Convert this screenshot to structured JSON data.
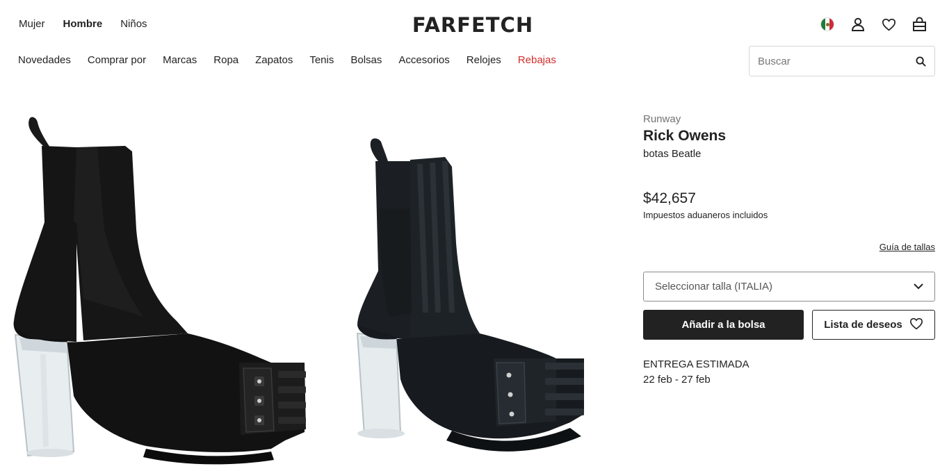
{
  "header": {
    "gender_tabs": [
      {
        "label": "Mujer"
      },
      {
        "label": "Hombre",
        "active": true
      },
      {
        "label": "Niños"
      }
    ],
    "logo": "FARFETCH",
    "icons": [
      "mexico-flag-icon",
      "account-icon",
      "wishlist-heart-icon",
      "shopping-bag-icon"
    ],
    "categories": [
      "Novedades",
      "Comprar por",
      "Marcas",
      "Ropa",
      "Zapatos",
      "Tenis",
      "Bolsas",
      "Accesorios",
      "Relojes",
      "Rebajas"
    ],
    "sale_color": "#d32e2e",
    "search": {
      "placeholder": "Buscar"
    }
  },
  "product": {
    "label": "Runway",
    "brand": "Rick Owens",
    "name": "botas Beatle",
    "price": "$42,657",
    "duties_note": "Impuestos aduaneros incluidos",
    "size_guide": "Guía de tallas",
    "size_select": "Seleccionar talla (ITALIA)",
    "add_to_bag": "Añadir a la bolsa",
    "wishlist": "Lista de deseos",
    "delivery_title": "ENTREGA ESTIMADA",
    "delivery_dates": "22 feb - 27 feb"
  },
  "colors": {
    "text": "#222222",
    "muted": "#727272",
    "button_dark": "#222222"
  }
}
